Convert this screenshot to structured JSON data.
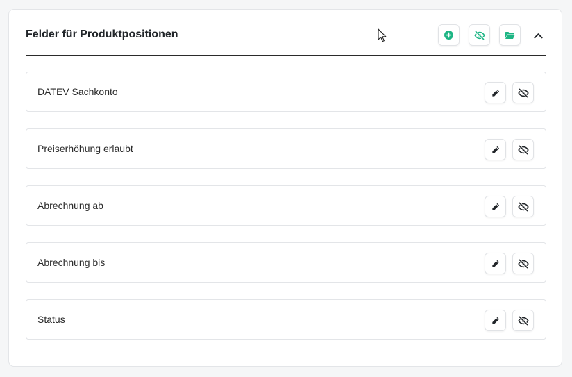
{
  "section": {
    "title": "Felder für Produktpositionen",
    "actions": [
      {
        "name": "add-field-button",
        "icon": "plus-circle-icon"
      },
      {
        "name": "show-hidden-button",
        "icon": "eye-slash-icon"
      },
      {
        "name": "open-folder-button",
        "icon": "folder-open-icon"
      }
    ],
    "collapse_icon": "chevron-up-icon"
  },
  "fields": [
    {
      "label": "DATEV Sachkonto"
    },
    {
      "label": "Preiserhöhung erlaubt"
    },
    {
      "label": "Abrechnung ab"
    },
    {
      "label": "Abrechnung bis"
    },
    {
      "label": "Status"
    }
  ],
  "colors": {
    "accent": "#1db584",
    "icon_dark": "#212529",
    "border": "#e3e5e8",
    "background": "#f5f6f7"
  }
}
